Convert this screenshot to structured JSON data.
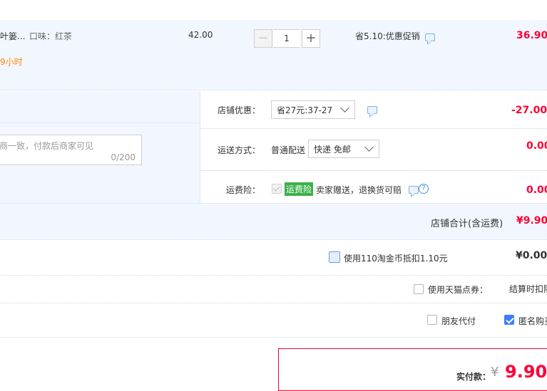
{
  "item": {
    "name_fragment": "叶篓...",
    "attribute": "口味：红茶",
    "price": "42.00",
    "quantity": "1",
    "promo": "省5.10:优惠促销",
    "subtotal": "36.90",
    "time_fragment": "9小时",
    "minus": "−",
    "plus": "+"
  },
  "shop": {
    "discount_label": "店铺优惠：",
    "discount_select": "省27元:37-27",
    "discount_amount": "-27.00",
    "shipping_label": "运送方式：",
    "shipping_method": "普通配送",
    "shipping_select": "快递 免邮",
    "shipping_amount": "0.00",
    "insurance_label": "运费险：",
    "insurance_badge": "运费险",
    "insurance_text": "卖家赠送，退换货可赔",
    "insurance_amount": "0.00",
    "message_placeholder": "商一致，付款后商家可见",
    "message_counter": "0/200",
    "total_label": "店铺合计(含运费)",
    "total_amount": "¥9.90"
  },
  "coins": {
    "label": "使用110淘金币抵扣1.10元",
    "amount": "¥0.00"
  },
  "tmall_points": {
    "label": "使用天猫点券：",
    "note": "结算时扣除"
  },
  "options": {
    "friend_pay": "朋友代付",
    "anonymous": "匿名购买"
  },
  "payment": {
    "label": "实付款：",
    "currency": "¥",
    "amount": "9.90"
  },
  "colors": {
    "accent_red": "#ff0036",
    "light_blue_bg": "#f2f7ff",
    "insurance_green": "#3bb14a",
    "checkbox_blue": "#3d7eff"
  }
}
